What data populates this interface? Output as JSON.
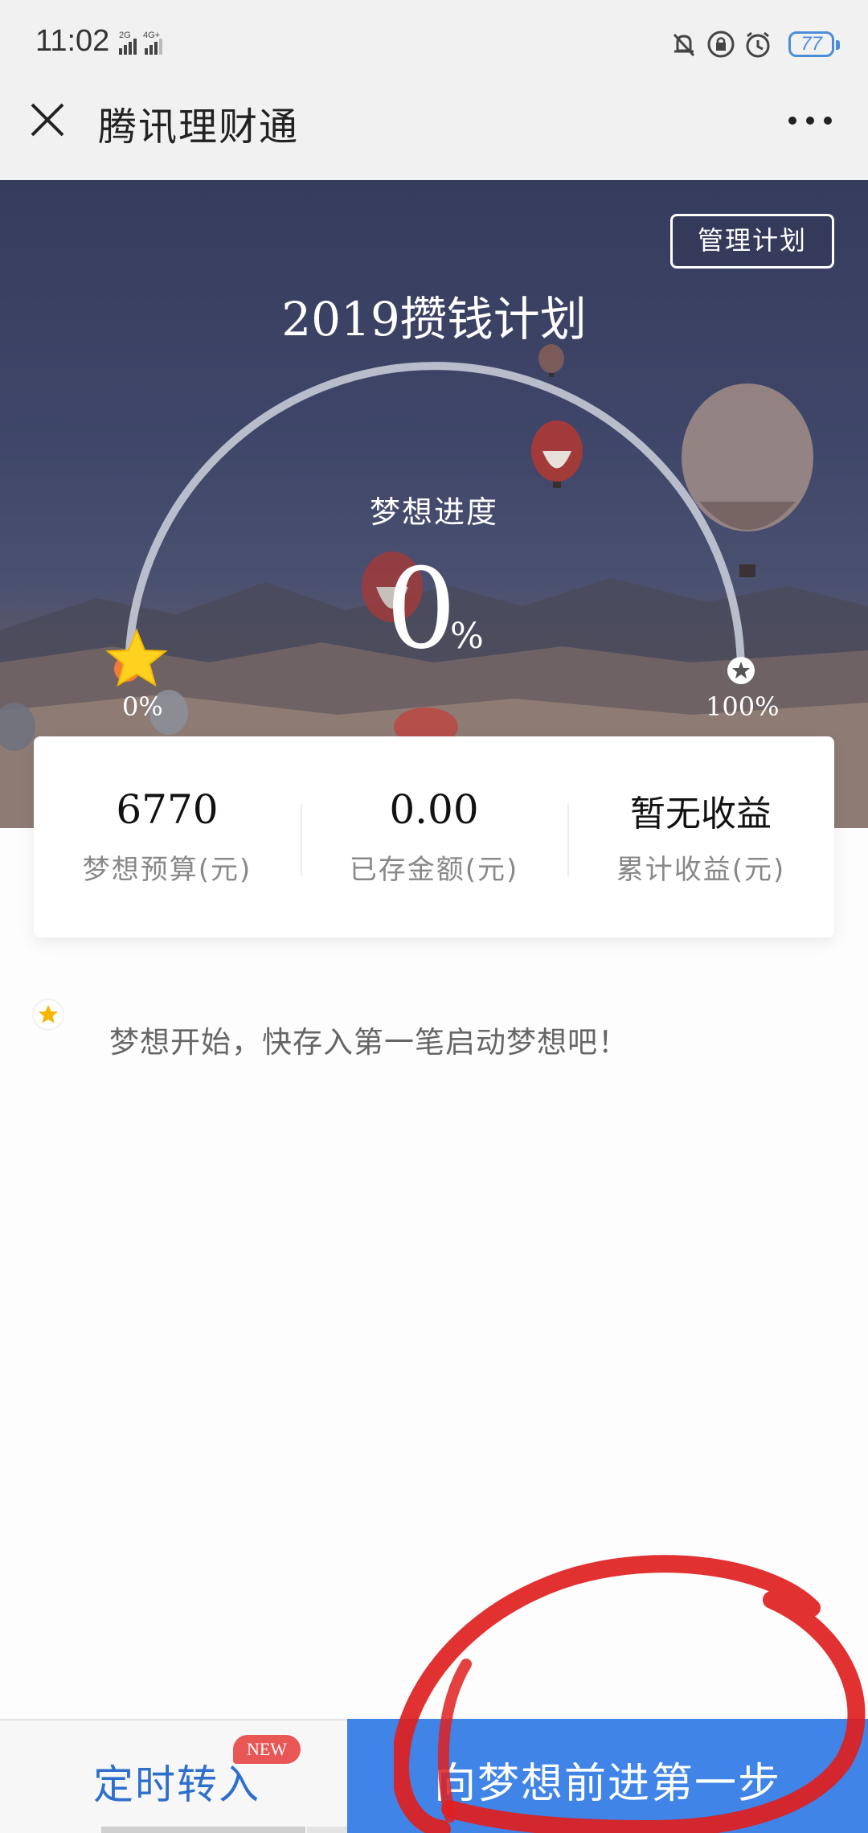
{
  "status_bar": {
    "time": "11:02",
    "network_primary": "2G",
    "network_secondary": "4G+",
    "battery": "77",
    "icons": [
      "mute-bell-icon",
      "lock-icon",
      "alarm-icon",
      "battery-icon"
    ]
  },
  "title_bar": {
    "title": "腾讯理财通",
    "close_icon": "close-icon",
    "more_icon": "more-icon"
  },
  "hero": {
    "manage_button": "管理计划",
    "title": "2019攒钱计划",
    "progress_label": "梦想进度",
    "progress_value": "0",
    "progress_unit": "%",
    "progress_fraction": 0,
    "start_label": "0%",
    "end_label": "100%"
  },
  "stats": [
    {
      "value": "6770",
      "label": "梦想预算(元)"
    },
    {
      "value": "0.00",
      "label": "已存金额(元)"
    },
    {
      "value": "暂无收益",
      "label": "累计收益(元)"
    }
  ],
  "message": {
    "text": "梦想开始，快存入第一笔启动梦想吧！"
  },
  "bottom_bar": {
    "schedule_button": "定时转入",
    "new_badge": "NEW",
    "primary_button": "向梦想前进第一步"
  },
  "colors": {
    "primary_blue": "#3f84e6",
    "badge_red": "#e85656",
    "annotation_red": "#e02020",
    "star_yellow": "#ffd21f"
  }
}
